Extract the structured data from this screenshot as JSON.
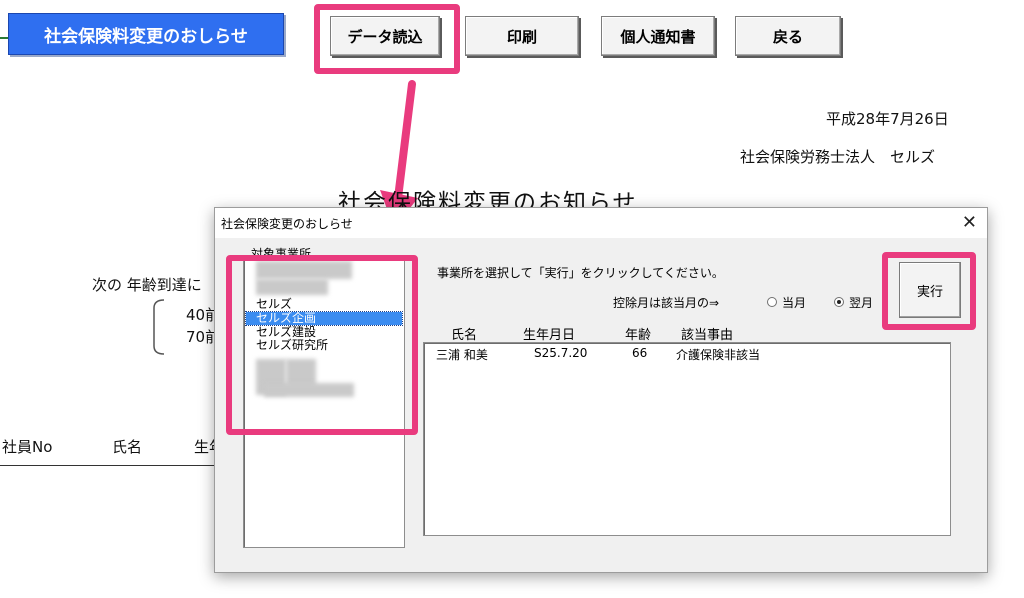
{
  "toolbar": {
    "notice_title": "社会保険料変更のおしらせ",
    "load_data": "データ読込",
    "print": "印刷",
    "individual_notice": "個人通知書",
    "back": "戻る"
  },
  "document": {
    "date": "平成28年7月26日",
    "issuer": "社会保険労務士法人　セルズ",
    "title_fragment": "社会保険料変更のお知らせ",
    "intro_fragment": "次の 年齢到達に",
    "age40": "40前",
    "age70": "70前",
    "col_employee_no": "社員No",
    "col_name": "氏名",
    "col_birth_fragment": "生年"
  },
  "dialog": {
    "title": "社会保険変更のおしらせ",
    "close": "✕",
    "office_label": "対象事業所",
    "offices": [
      "セルズ",
      "セルズ企画",
      "セルズ建設",
      "セルズ研究所"
    ],
    "selected_office": "セルズ企画",
    "instruction": "事業所を選択して「実行」をクリックしてください。",
    "deduction_label": "控除月は該当月の⇒",
    "radio_current": "当月",
    "radio_next": "翌月",
    "radio_selected": "翌月",
    "execute": "実行",
    "columns": {
      "name": "氏名",
      "birth": "生年月日",
      "age": "年齢",
      "reason": "該当事由"
    },
    "rows": [
      {
        "name": "三浦 和美",
        "birth": "S25.7.20",
        "age": "66",
        "reason": "介護保険非該当"
      }
    ]
  },
  "colors": {
    "highlight": "#e93b7e",
    "title_button": "#2f6ff0",
    "selection": "#3b8cf0"
  }
}
